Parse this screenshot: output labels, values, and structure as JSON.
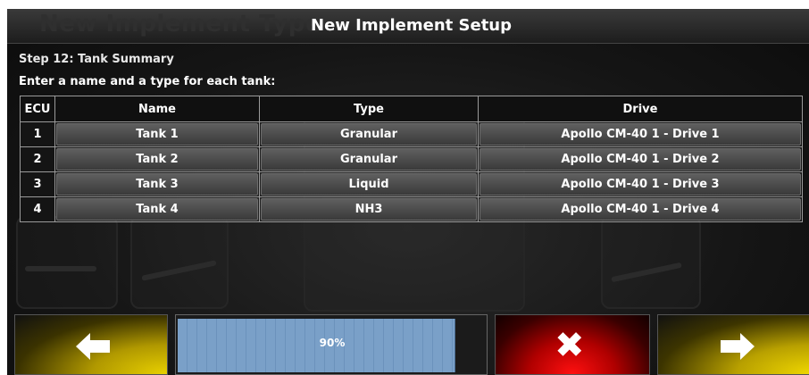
{
  "header": {
    "ghost_title": "New Implement Type",
    "title": "New Implement Setup"
  },
  "step": {
    "label": "Step 12: Tank Summary",
    "instruction": "Enter a name and a type for each tank:"
  },
  "table": {
    "columns": [
      "ECU",
      "Name",
      "Type",
      "Drive"
    ],
    "rows": [
      {
        "ecu": "1",
        "name": "Tank 1",
        "type": "Granular",
        "drive": "Apollo CM-40 1 - Drive 1"
      },
      {
        "ecu": "2",
        "name": "Tank 2",
        "type": "Granular",
        "drive": "Apollo CM-40 1 - Drive 2"
      },
      {
        "ecu": "3",
        "name": "Tank 3",
        "type": "Liquid",
        "drive": "Apollo CM-40 1 - Drive 3"
      },
      {
        "ecu": "4",
        "name": "Tank 4",
        "type": "NH3",
        "drive": "Apollo CM-40 1 - Drive 4"
      }
    ]
  },
  "footer": {
    "back_icon": "arrow-left-icon",
    "cancel_icon": "close-icon",
    "next_icon": "arrow-right-icon",
    "progress_label": "90%",
    "progress_fraction": 0.9,
    "colors": {
      "back": "#e8d000",
      "cancel": "#ff1010",
      "next": "#f0d800",
      "progress": "#7aa0c8"
    }
  }
}
